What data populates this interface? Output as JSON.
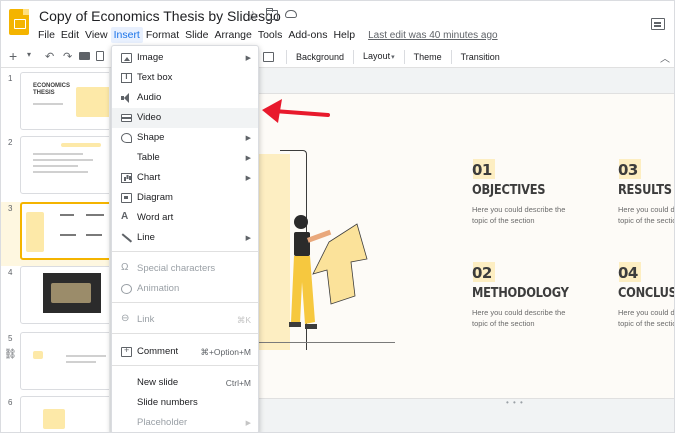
{
  "app": {
    "doc_title": "Copy of Economics Thesis by Slidesgo",
    "last_edit": "Last edit was 40 minutes ago"
  },
  "menubar": [
    "File",
    "Edit",
    "View",
    "Insert",
    "Format",
    "Slide",
    "Arrange",
    "Tools",
    "Add-ons",
    "Help"
  ],
  "toolbar": {
    "new_slide": "+",
    "background": "Background",
    "layout": "Layout",
    "theme": "Theme",
    "transition": "Transition"
  },
  "filmstrip": {
    "selected_index": 3,
    "thumbs": [
      {
        "num": "1",
        "title": "ECONOMICS\nTHESIS"
      },
      {
        "num": "2"
      },
      {
        "num": "3"
      },
      {
        "num": "4"
      },
      {
        "num": "5"
      },
      {
        "num": "6"
      }
    ]
  },
  "slide": {
    "items": [
      {
        "num": "01",
        "title": "OBJECTIVES",
        "desc": "Here you could describe the topic of the section"
      },
      {
        "num": "03",
        "title": "RESULTS ANALYSIS",
        "desc": "Here you could describe the topic of the section"
      },
      {
        "num": "02",
        "title": "METHODOLOGY",
        "desc": "Here you could describe the topic of the section"
      },
      {
        "num": "04",
        "title": "CONCLUSIONS",
        "desc": "Here you could describe the topic of the section"
      }
    ]
  },
  "insert_menu": {
    "items": [
      {
        "label": "Image",
        "icon": "image-icon",
        "has_submenu": true,
        "enabled": true
      },
      {
        "label": "Text box",
        "icon": "textbox-icon",
        "enabled": true
      },
      {
        "label": "Audio",
        "icon": "audio-icon",
        "enabled": true
      },
      {
        "label": "Video",
        "icon": "video-icon",
        "enabled": true,
        "highlighted": true
      },
      {
        "label": "Shape",
        "icon": "shape-icon",
        "has_submenu": true,
        "enabled": true
      },
      {
        "label": "Table",
        "icon": "",
        "has_submenu": true,
        "enabled": true
      },
      {
        "label": "Chart",
        "icon": "chart-icon",
        "has_submenu": true,
        "enabled": true
      },
      {
        "label": "Diagram",
        "icon": "diagram-icon",
        "enabled": true
      },
      {
        "label": "Word art",
        "icon": "wordart-icon",
        "enabled": true
      },
      {
        "label": "Line",
        "icon": "line-icon",
        "has_submenu": true,
        "enabled": true
      },
      {
        "label": "Special characters",
        "icon": "special-characters-icon",
        "enabled": false
      },
      {
        "label": "Animation",
        "icon": "animation-icon",
        "enabled": false
      },
      {
        "label": "Link",
        "icon": "link-icon",
        "shortcut": "⌘K",
        "enabled": false
      },
      {
        "label": "Comment",
        "icon": "comment-icon",
        "shortcut": "⌘+Option+M",
        "enabled": true
      },
      {
        "label": "New slide",
        "icon": "",
        "shortcut": "Ctrl+M",
        "enabled": true
      },
      {
        "label": "Slide numbers",
        "icon": "",
        "enabled": true
      },
      {
        "label": "Placeholder",
        "icon": "",
        "has_submenu": true,
        "enabled": false
      }
    ]
  },
  "colors": {
    "accent": "#f4b400",
    "selection_bg": "#fef7e0",
    "annotation_arrow": "#e8192c",
    "slide_highlight": "#fdeec2"
  }
}
